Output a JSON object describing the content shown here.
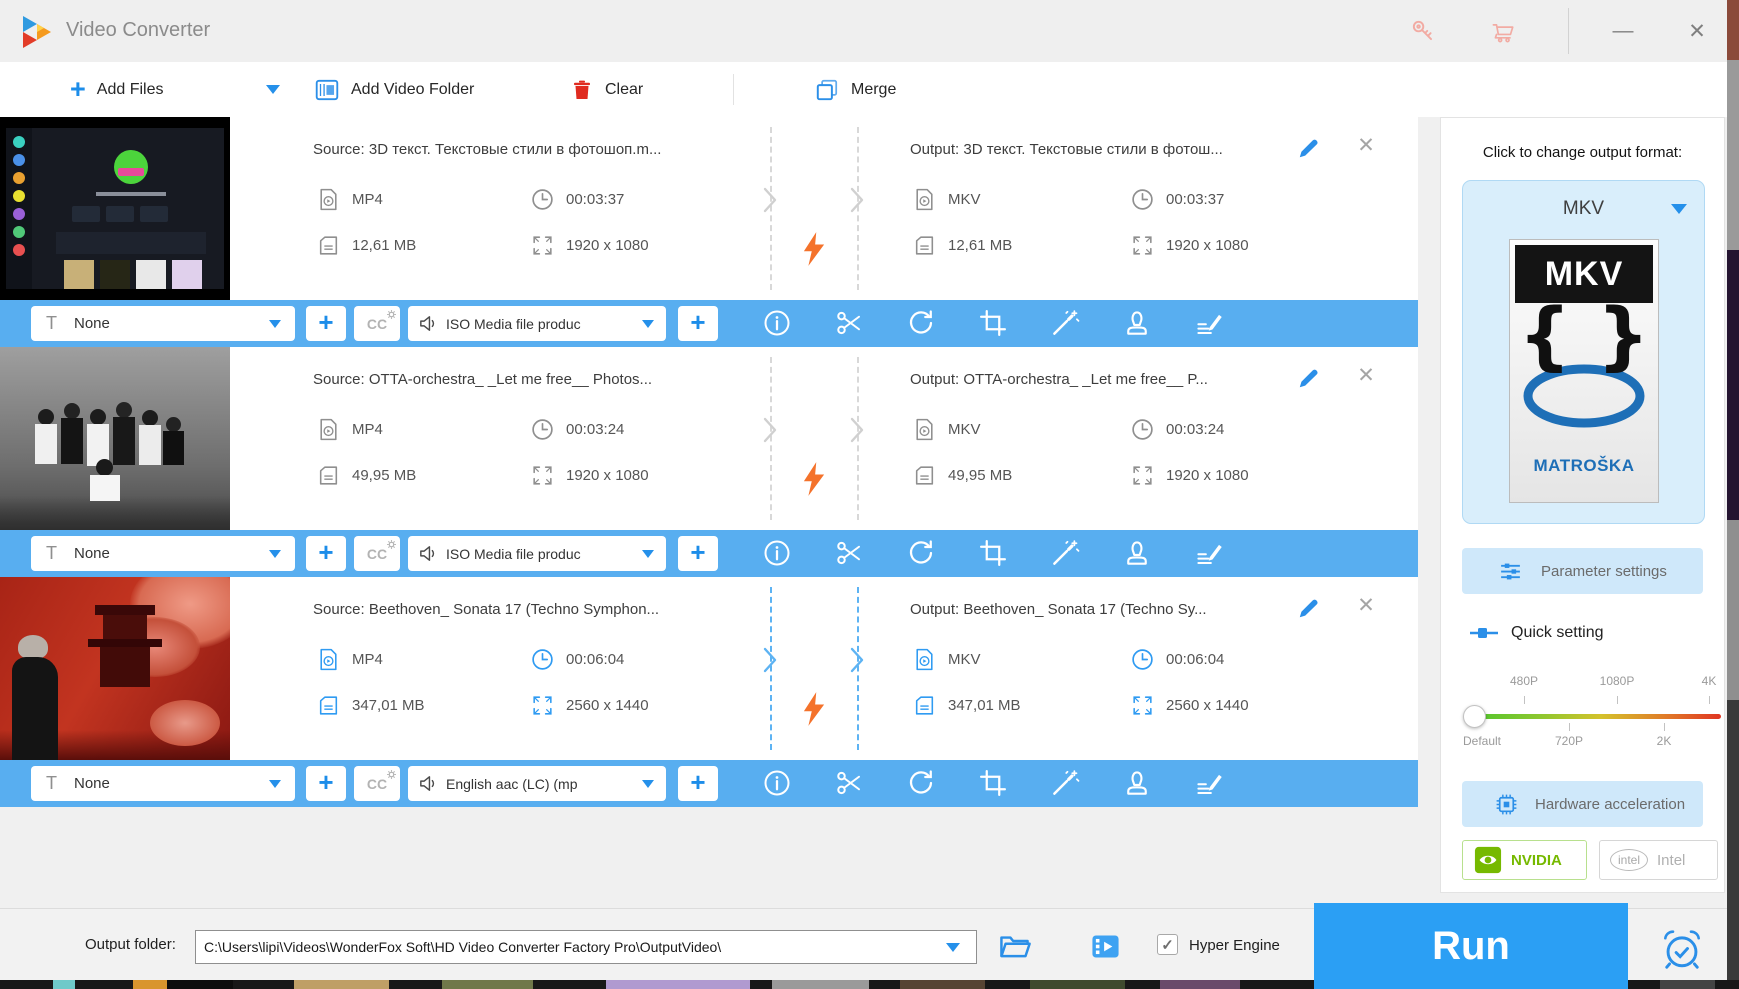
{
  "window": {
    "title": "Video Converter"
  },
  "glyphs": {
    "plus": "+",
    "minimize": "—",
    "close": "✕",
    "row_close": "✕",
    "check": "✓",
    "subtitle_icon": "T",
    "cc": "CC"
  },
  "toolbar": {
    "add_files": "Add Files",
    "add_video_folder": "Add Video Folder",
    "clear": "Clear",
    "merge": "Merge"
  },
  "rows": [
    {
      "source_title": "Source: 3D текст. Текстовые стили в фотошоп.m...",
      "source_format": "MP4",
      "source_duration": "00:03:37",
      "source_size": "12,61 MB",
      "source_resolution": "1920 x 1080",
      "output_title": "Output: 3D текст. Текстовые стили в фотош...",
      "output_format": "MKV",
      "output_duration": "00:03:37",
      "output_size": "12,61 MB",
      "output_resolution": "1920 x 1080",
      "subtitle": "None",
      "audio": "ISO Media file produc"
    },
    {
      "source_title": "Source: OTTA-orchestra_ _Let me free__ Photos...",
      "source_format": "MP4",
      "source_duration": "00:03:24",
      "source_size": "49,95 MB",
      "source_resolution": "1920 x 1080",
      "output_title": "Output: OTTA-orchestra_ _Let me free__ P...",
      "output_format": "MKV",
      "output_duration": "00:03:24",
      "output_size": "49,95 MB",
      "output_resolution": "1920 x 1080",
      "subtitle": "None",
      "audio": "ISO Media file produc"
    },
    {
      "source_title": "Source: Beethoven_ Sonata 17 (Techno Symphon...",
      "source_format": "MP4",
      "source_duration": "00:06:04",
      "source_size": "347,01 MB",
      "source_resolution": "2560 x 1440",
      "output_title": "Output: Beethoven_ Sonata 17 (Techno Sy...",
      "output_format": "MKV",
      "output_duration": "00:06:04",
      "output_size": "347,01 MB",
      "output_resolution": "2560 x 1440",
      "subtitle": "None",
      "audio": "English aac (LC) (mp"
    }
  ],
  "panel": {
    "header": "Click to change output format:",
    "format": "MKV",
    "logo_top": "MKV",
    "logo_braces": "{ }",
    "logo_brand": "MATROŠKA",
    "parameter_settings": "Parameter settings",
    "quick_setting": "Quick setting",
    "labels_top": [
      "480P",
      "1080P",
      "4K"
    ],
    "labels_bottom": [
      "Default",
      "720P",
      "2K"
    ],
    "hardware_acceleration": "Hardware acceleration",
    "nvidia": "NVIDIA",
    "intel": "Intel",
    "intel_logo": "intel"
  },
  "bottom": {
    "output_folder_label": "Output folder:",
    "output_folder_path": "C:\\Users\\lipi\\Videos\\WonderFox Soft\\HD Video Converter Factory Pro\\OutputVideo\\",
    "hyper_engine": "Hyper Engine",
    "run": "Run"
  },
  "colors": {
    "accent": "#2b8fe8",
    "bar_blue": "#58aef0",
    "bolt_orange": "#f4722b",
    "nvidia_green": "#76b900",
    "clear_red": "#e02b20"
  }
}
